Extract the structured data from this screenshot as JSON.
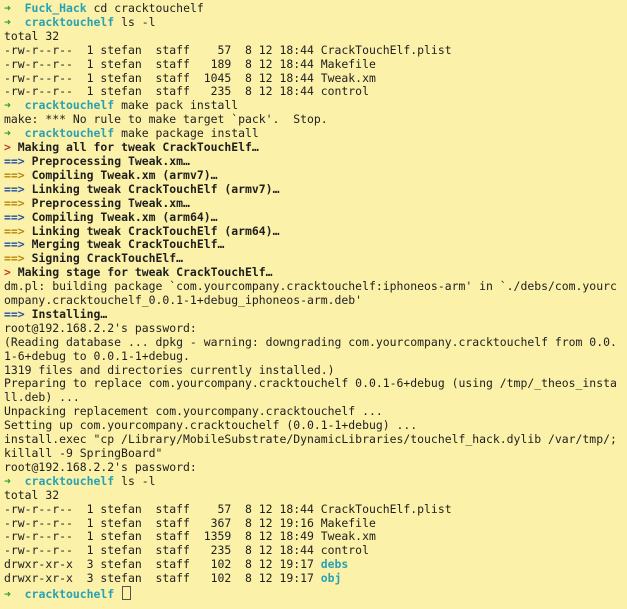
{
  "prompt": {
    "arrow": "➜",
    "dir_first": "Fuck_Hack",
    "dir": "cracktouchelf"
  },
  "commands": {
    "cd": "cd cracktouchelf",
    "ls": "ls -l",
    "make_pack": "make pack install",
    "make_package": "make package install"
  },
  "listing1": {
    "total": "total 32",
    "rows": [
      "-rw-r--r--  1 stefan  staff    57  8 12 18:44 CrackTouchElf.plist",
      "-rw-r--r--  1 stefan  staff   189  8 12 18:44 Makefile",
      "-rw-r--r--  1 stefan  staff  1045  8 12 18:44 Tweak.xm",
      "-rw-r--r--  1 stefan  staff   235  8 12 18:44 control"
    ]
  },
  "make_error": "make: *** No rule to make target `pack'.  Stop.",
  "build": {
    "head_marker": ">",
    "step_marker": "==>",
    "making_all": "Making all for tweak CrackTouchElf…",
    "steps": [
      "Preprocessing Tweak.xm…",
      "Compiling Tweak.xm (armv7)…",
      "Linking tweak CrackTouchElf (armv7)…",
      "Preprocessing Tweak.xm…",
      "Compiling Tweak.xm (arm64)…",
      "Linking tweak CrackTouchElf (arm64)…",
      "Merging tweak CrackTouchElf…",
      "Signing CrackTouchElf…"
    ],
    "making_stage": "Making stage for tweak CrackTouchElf…",
    "dm_line": "dm.pl: building package `com.yourcompany.cracktouchelf:iphoneos-arm' in `./debs/com.yourcompany.cracktouchelf_0.0.1-1+debug_iphoneos-arm.deb'",
    "installing": "Installing…"
  },
  "install_output": [
    "root@192.168.2.2's password:",
    "(Reading database ... dpkg - warning: downgrading com.yourcompany.cracktouchelf from 0.0.1-6+debug to 0.0.1-1+debug.",
    "1319 files and directories currently installed.)",
    "Preparing to replace com.yourcompany.cracktouchelf 0.0.1-6+debug (using /tmp/_theos_install.deb) ...",
    "Unpacking replacement com.yourcompany.cracktouchelf ...",
    "Setting up com.yourcompany.cracktouchelf (0.0.1-1+debug) ...",
    "install.exec \"cp /Library/MobileSubstrate/DynamicLibraries/touchelf_hack.dylib /var/tmp/;killall -9 SpringBoard\"",
    "root@192.168.2.2's password:"
  ],
  "listing2": {
    "total": "total 32",
    "rows": [
      "-rw-r--r--  1 stefan  staff    57  8 12 18:44 CrackTouchElf.plist",
      "-rw-r--r--  1 stefan  staff   367  8 12 19:16 Makefile",
      "-rw-r--r--  1 stefan  staff  1359  8 12 18:49 Tweak.xm",
      "-rw-r--r--  1 stefan  staff   235  8 12 18:44 control"
    ],
    "dir_rows": [
      {
        "meta": "drwxr-xr-x  3 stefan  staff   102  8 12 19:17 ",
        "name": "debs"
      },
      {
        "meta": "drwxr-xr-x  3 stefan  staff   102  8 12 19:17 ",
        "name": "obj"
      }
    ]
  },
  "colors": {
    "background": "#fbf1a9",
    "prompt_arrow": "#2e9e2e",
    "prompt_dir": "#2aa1b3",
    "step_arrow": "#1f4fa8",
    "step_arrow_alt": "#b8860b",
    "head_marker": "#c0392b"
  }
}
